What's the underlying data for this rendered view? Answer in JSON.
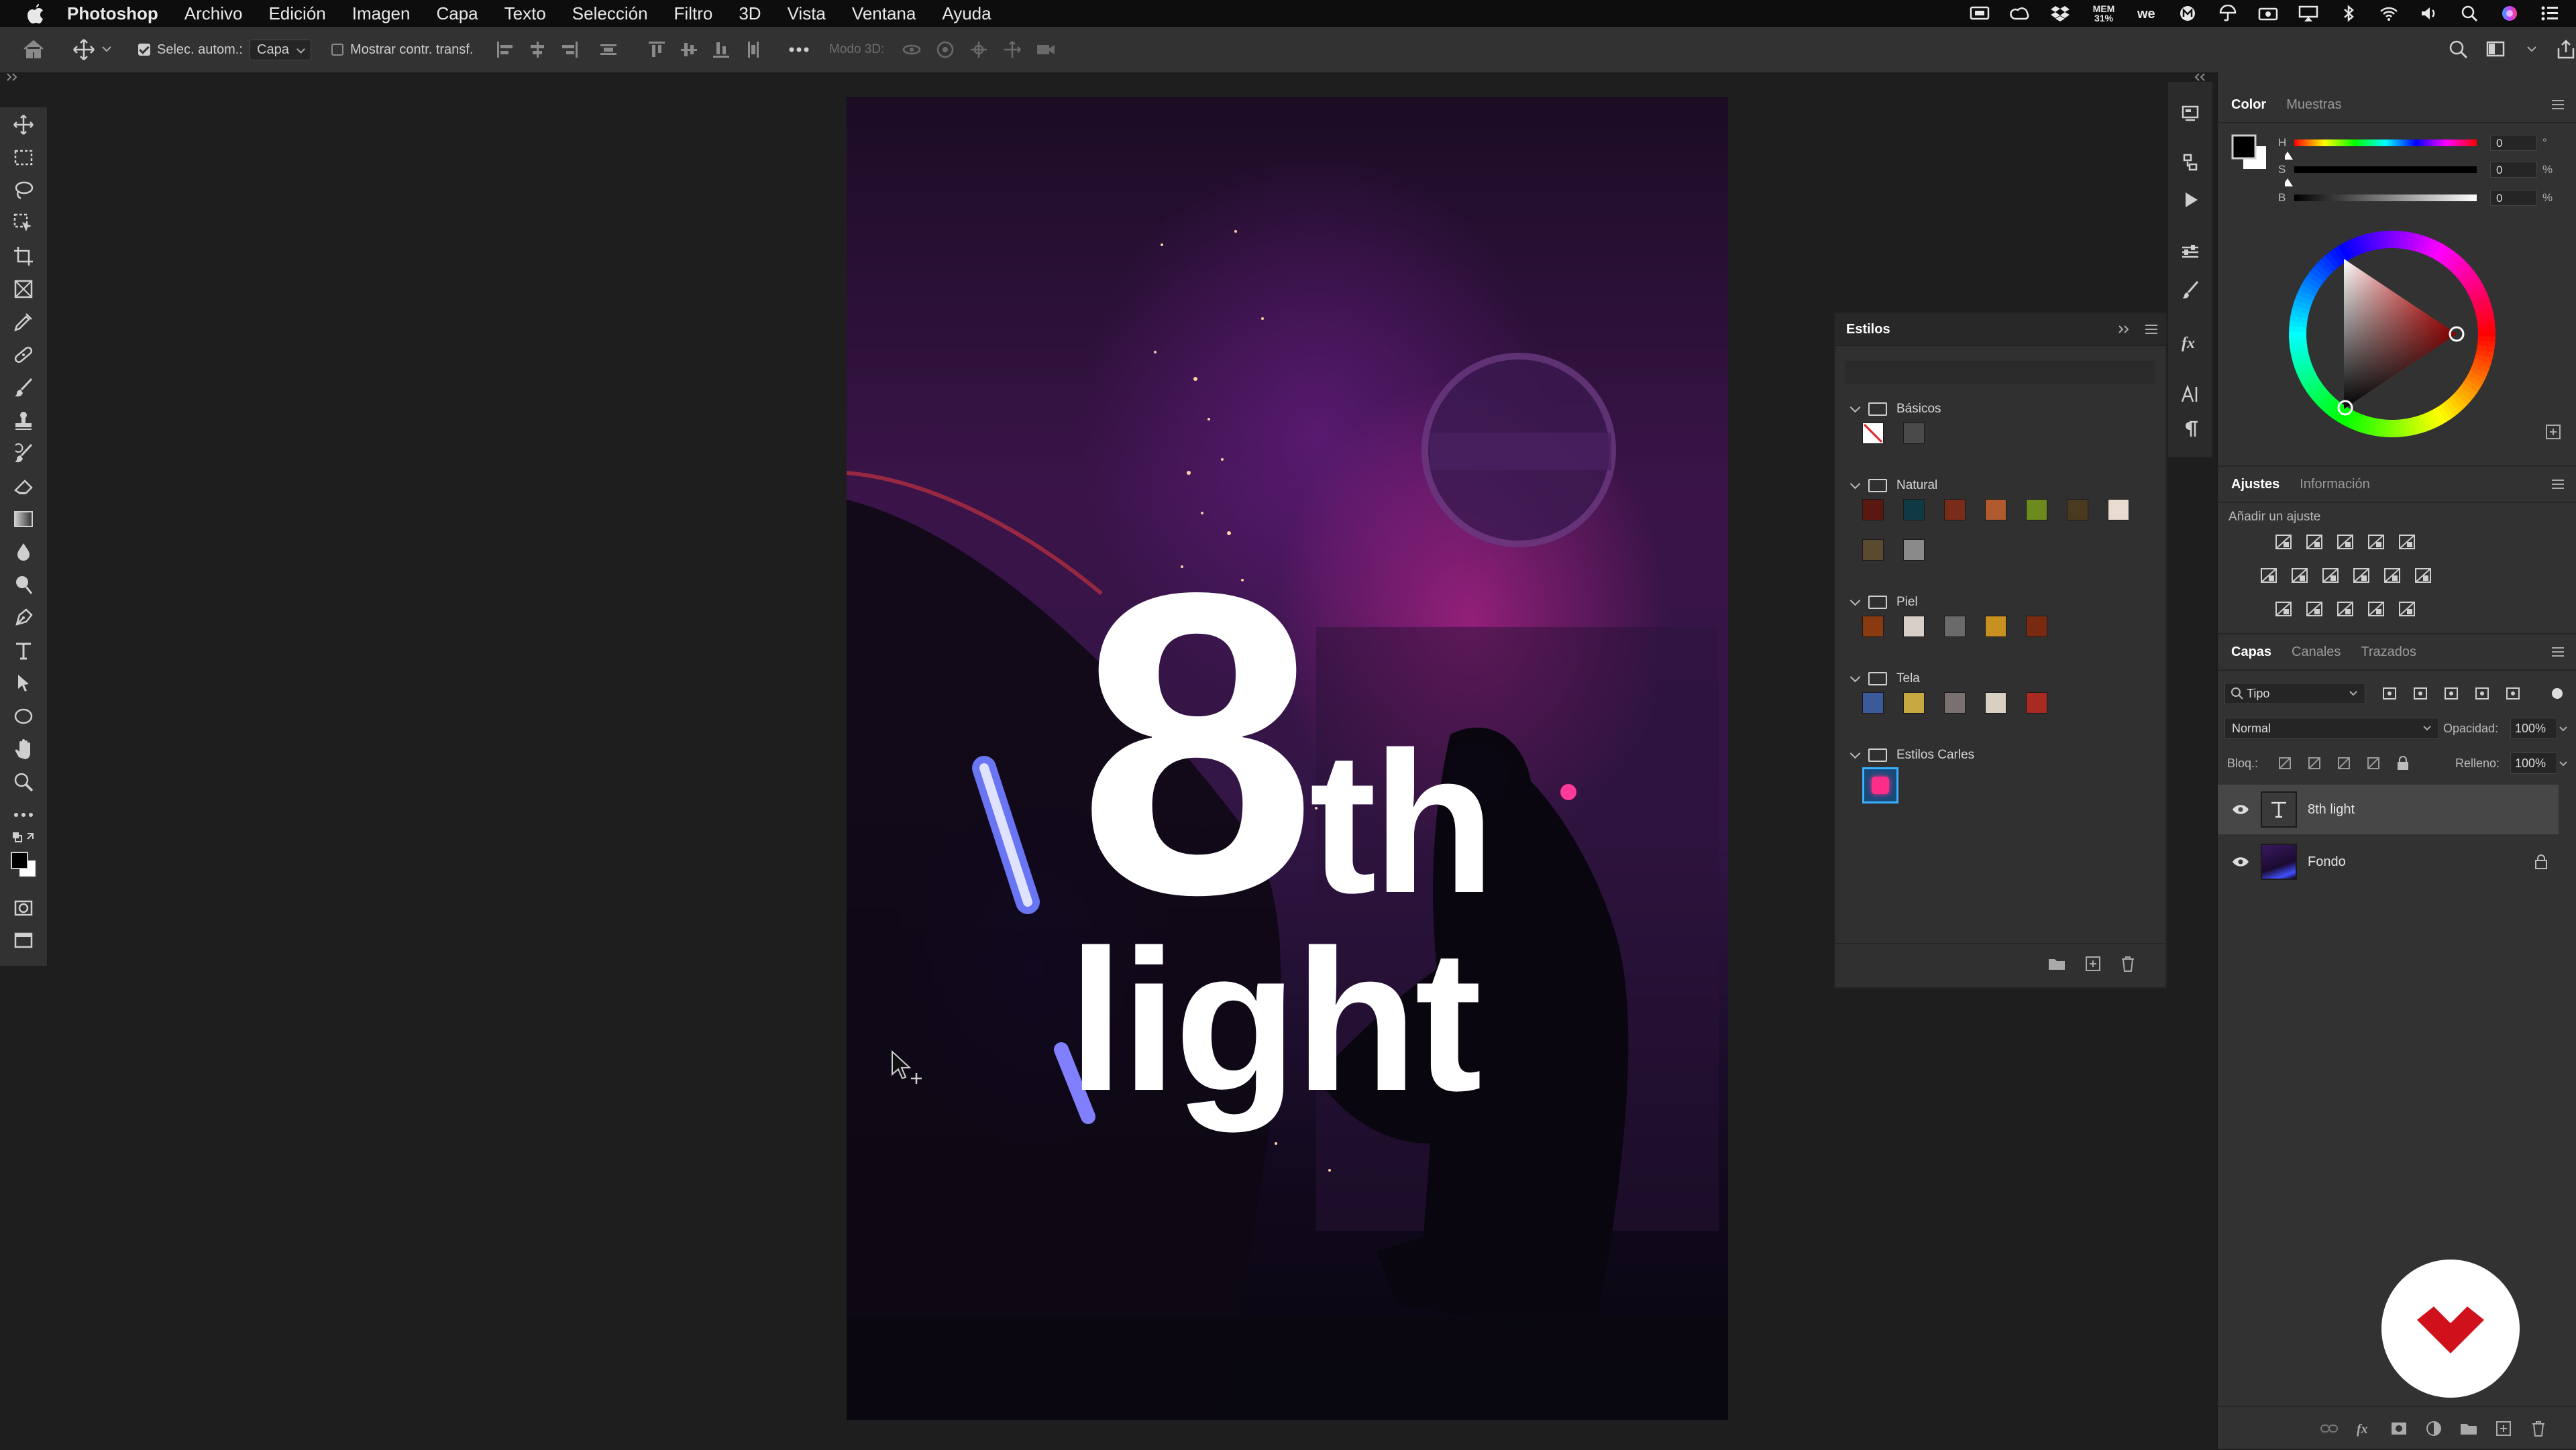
{
  "menubar": {
    "app_name": "Photoshop",
    "items": [
      "Archivo",
      "Edición",
      "Imagen",
      "Capa",
      "Texto",
      "Selección",
      "Filtro",
      "3D",
      "Vista",
      "Ventana",
      "Ayuda"
    ],
    "mem_label": "MEM",
    "mem_value": "31%"
  },
  "options_bar": {
    "auto_select_label": "Selec. autom.:",
    "auto_select_value": "Capa",
    "show_transform_label": "Mostrar contr. transf.",
    "mode3d_label": "Modo 3D:"
  },
  "canvas": {
    "text_line1_big": "8",
    "text_line1_small": "th",
    "text_line2": "light"
  },
  "styles_panel": {
    "title": "Estilos",
    "groups": [
      {
        "name": "Básicos",
        "swatches": [
          "#ffffff",
          "#4a4a4a"
        ]
      },
      {
        "name": "Natural",
        "swatches": [
          "#5a1810",
          "#0f3a44",
          "#7a2c1a",
          "#b05a30",
          "#6c8a1e",
          "#4a3a20",
          "#e8dcd0",
          "#5a4a30",
          "#8a8a8a"
        ]
      },
      {
        "name": "Piel",
        "swatches": [
          "#8a3a10",
          "#d8d0c8",
          "#6a6a6a",
          "#c89020",
          "#7a2a10"
        ]
      },
      {
        "name": "Tela",
        "swatches": [
          "#3a5a9a",
          "#c8a840",
          "#7a7070",
          "#d8d0c0",
          "#a82a20"
        ]
      },
      {
        "name": "Estilos Carles",
        "swatches": [
          "#ff2d8a"
        ]
      }
    ]
  },
  "color_panel": {
    "tabs": [
      "Color",
      "Muestras"
    ],
    "sliders": [
      {
        "label": "H",
        "value": "0",
        "unit": "°"
      },
      {
        "label": "S",
        "value": "0",
        "unit": "%"
      },
      {
        "label": "B",
        "value": "0",
        "unit": "%"
      }
    ]
  },
  "adjust_panel": {
    "tabs": [
      "Ajustes",
      "Información"
    ],
    "hint": "Añadir un ajuste"
  },
  "layers_panel": {
    "tabs": [
      "Capas",
      "Canales",
      "Trazados"
    ],
    "filter_label": "Tipo",
    "blend_mode": "Normal",
    "opacity_label": "Opacidad:",
    "opacity_value": "100%",
    "lock_label": "Bloq.:",
    "fill_label": "Relleno:",
    "fill_value": "100%",
    "layers": [
      {
        "name": "8th light",
        "type": "text"
      },
      {
        "name": "Fondo",
        "type": "image"
      }
    ]
  },
  "colors": {
    "bg": "#1e1e1e",
    "panel": "#323232",
    "accent_logo": "#d0101a"
  }
}
